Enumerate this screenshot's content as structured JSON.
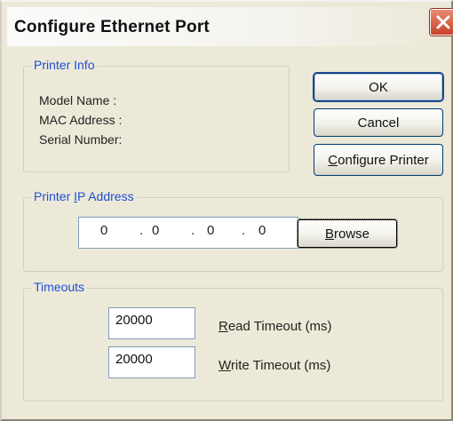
{
  "window": {
    "title": "Configure Ethernet Port",
    "close_label": "×"
  },
  "printer_info": {
    "group_label": "Printer Info",
    "model_name_label": "Model Name  :",
    "mac_address_label": "MAC Address :",
    "serial_number_label": "Serial Number:",
    "model_name_value": "",
    "mac_address_value": "",
    "serial_number_value": ""
  },
  "buttons": {
    "ok": "OK",
    "cancel": "Cancel",
    "configure_first": "C",
    "configure_rest": "onfigure Printer",
    "browse_first": "B",
    "browse_rest": "rowse"
  },
  "ip_group": {
    "label_prefix": "Printer ",
    "label_mnemonic": "I",
    "label_suffix": "P Address",
    "octets": [
      "0",
      "0",
      "0",
      "0"
    ],
    "dot": "."
  },
  "timeouts": {
    "group_label": "Timeouts",
    "read_value": "20000",
    "write_value": "20000",
    "read_label_first": "R",
    "read_label_rest": "ead Timeout (ms)",
    "write_label_first": "W",
    "write_label_rest": "rite Timeout (ms)"
  }
}
